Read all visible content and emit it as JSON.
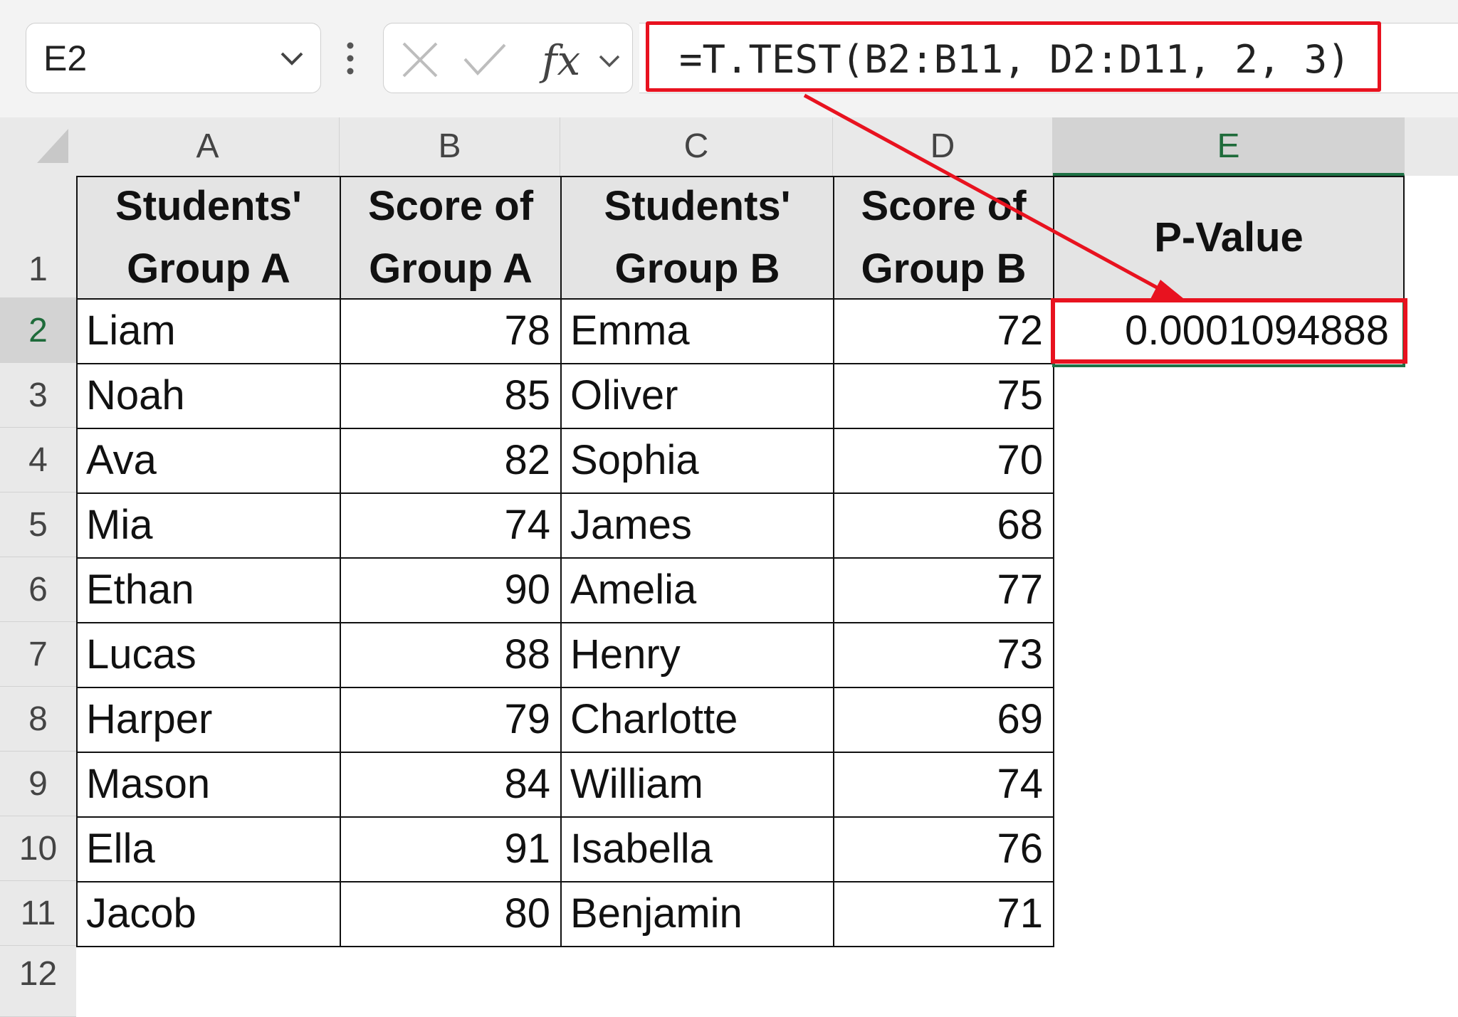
{
  "name_box": {
    "value": "E2"
  },
  "fx_label": "fx",
  "formula": "=T.TEST(B2:B11, D2:D11, 2, 3)",
  "columns": [
    "A",
    "B",
    "C",
    "D",
    "E"
  ],
  "rows": [
    "1",
    "2",
    "3",
    "4",
    "5",
    "6",
    "7",
    "8",
    "9",
    "10",
    "11",
    "12"
  ],
  "headers": {
    "a_line1": "Students'",
    "a_line2": "Group A",
    "b_line1": "Score of",
    "b_line2": "Group A",
    "c_line1": "Students'",
    "c_line2": "Group B",
    "d_line1": "Score of",
    "d_line2": "Group B",
    "e": "P-Value"
  },
  "data_rows": [
    {
      "a": "Liam",
      "b": "78",
      "c": "Emma",
      "d": "72"
    },
    {
      "a": "Noah",
      "b": "85",
      "c": "Oliver",
      "d": "75"
    },
    {
      "a": "Ava",
      "b": "82",
      "c": "Sophia",
      "d": "70"
    },
    {
      "a": "Mia",
      "b": "74",
      "c": "James",
      "d": "68"
    },
    {
      "a": "Ethan",
      "b": "90",
      "c": "Amelia",
      "d": "77"
    },
    {
      "a": "Lucas",
      "b": "88",
      "c": "Henry",
      "d": "73"
    },
    {
      "a": "Harper",
      "b": "79",
      "c": "Charlotte",
      "d": "69"
    },
    {
      "a": "Mason",
      "b": "84",
      "c": "William",
      "d": "74"
    },
    {
      "a": "Ella",
      "b": "91",
      "c": "Isabella",
      "d": "76"
    },
    {
      "a": "Jacob",
      "b": "80",
      "c": "Benjamin",
      "d": "71"
    }
  ],
  "p_value": "0.0001094888",
  "colors": {
    "highlight": "#e8121f",
    "selection": "#1e7145",
    "header_fill": "#e4e4e4"
  },
  "icons": {
    "name_box_dropdown": "chevron-down-icon",
    "more": "vertical-dots-icon",
    "cancel": "x-icon",
    "enter": "check-icon",
    "fx_dropdown": "chevron-down-icon"
  }
}
